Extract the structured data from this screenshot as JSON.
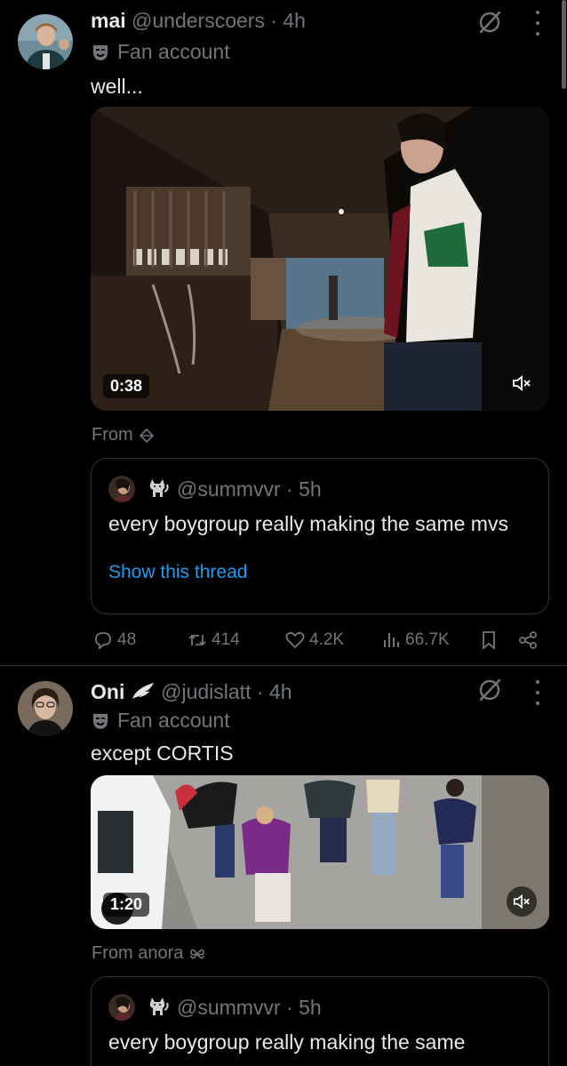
{
  "tweets": [
    {
      "name": "mai",
      "handle": "@underscoers",
      "time": " · 4h",
      "badge": "Fan account",
      "text": "well...",
      "video_duration": "0:38",
      "from": "From",
      "quote": {
        "handle": "@summvvr",
        "time": " · 5h",
        "text": "every boygroup really making the same mvs",
        "link": "Show this thread"
      },
      "actions": {
        "replies": "48",
        "reposts": "414",
        "likes": "4.2K",
        "views": "66.7K"
      }
    },
    {
      "name": "Oni",
      "handle": "@judislatt",
      "time": " · 4h",
      "badge": "Fan account",
      "text": "except CORTIS",
      "video_duration": "1:20",
      "from": "From anora",
      "quote": {
        "handle": "@summvvr",
        "time": " · 5h",
        "text": "every boygroup really making the same"
      }
    }
  ],
  "icons": {
    "grok": "grok-icon",
    "more": "more-icon",
    "mute": "mute-icon",
    "reply": "reply-icon",
    "repost": "repost-icon",
    "like": "like-icon",
    "views": "views-icon",
    "bookmark": "bookmark-icon",
    "share": "share-icon"
  },
  "colors": {
    "background": "#000000",
    "text": "#e7e9ea",
    "muted": "#71767b",
    "link": "#1d9bf0",
    "border": "#2f3336"
  }
}
